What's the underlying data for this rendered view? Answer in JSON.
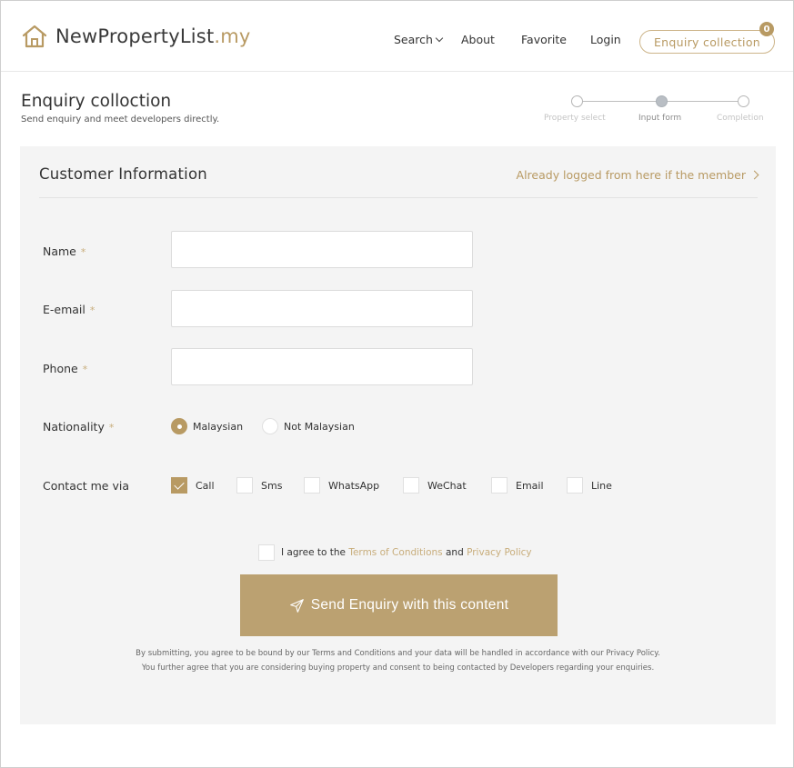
{
  "header": {
    "logo_main": "NewPropertyList",
    "logo_domain": ".my",
    "nav": {
      "search": "Search",
      "about": "About",
      "favorite": "Favorite",
      "login": "Login"
    },
    "enquiry_button": "Enquiry collection",
    "enquiry_count": "0"
  },
  "page": {
    "title": "Enquiry colloction",
    "subtitle": "Send enquiry and meet developers directly."
  },
  "steps": [
    {
      "label": "Property select",
      "state": "done"
    },
    {
      "label": "Input form",
      "state": "active"
    },
    {
      "label": "Completion",
      "state": "pending"
    }
  ],
  "panel": {
    "title": "Customer Information",
    "login_link": "Already logged from here if the member",
    "fields": {
      "name": {
        "label": "Name",
        "required_mark": "*",
        "value": ""
      },
      "email": {
        "label": "E-email",
        "required_mark": "*",
        "value": ""
      },
      "phone": {
        "label": "Phone",
        "required_mark": "*",
        "value": ""
      }
    },
    "nationality": {
      "label": "Nationality",
      "required_mark": "*",
      "options": [
        "Malaysian",
        "Not Malaysian"
      ],
      "selected": "Malaysian"
    },
    "contact": {
      "label": "Contact me via",
      "options": [
        "Call",
        "Sms",
        "WhatsApp",
        "WeChat",
        "Email",
        "Line"
      ],
      "checked": [
        "Call"
      ]
    },
    "agree": {
      "prefix": "I agree to the",
      "terms": "Terms of Conditions",
      "and": "and",
      "privacy": "Privacy Policy"
    },
    "submit_label": "Send Enquiry with this content",
    "disclaimer_line1": "By submitting, you agree to be bound by our Terms and Conditions and your data will be handled in accordance with our Privacy Policy.",
    "disclaimer_line2": "You further agree that you are considering buying property and consent to being contacted by Developers regarding your enquiries."
  },
  "colors": {
    "accent": "#b89a63",
    "button": "#bba171",
    "panel_bg": "#f4f4f4"
  },
  "icons": {
    "logo": "house-icon",
    "submit": "paper-plane-icon"
  }
}
